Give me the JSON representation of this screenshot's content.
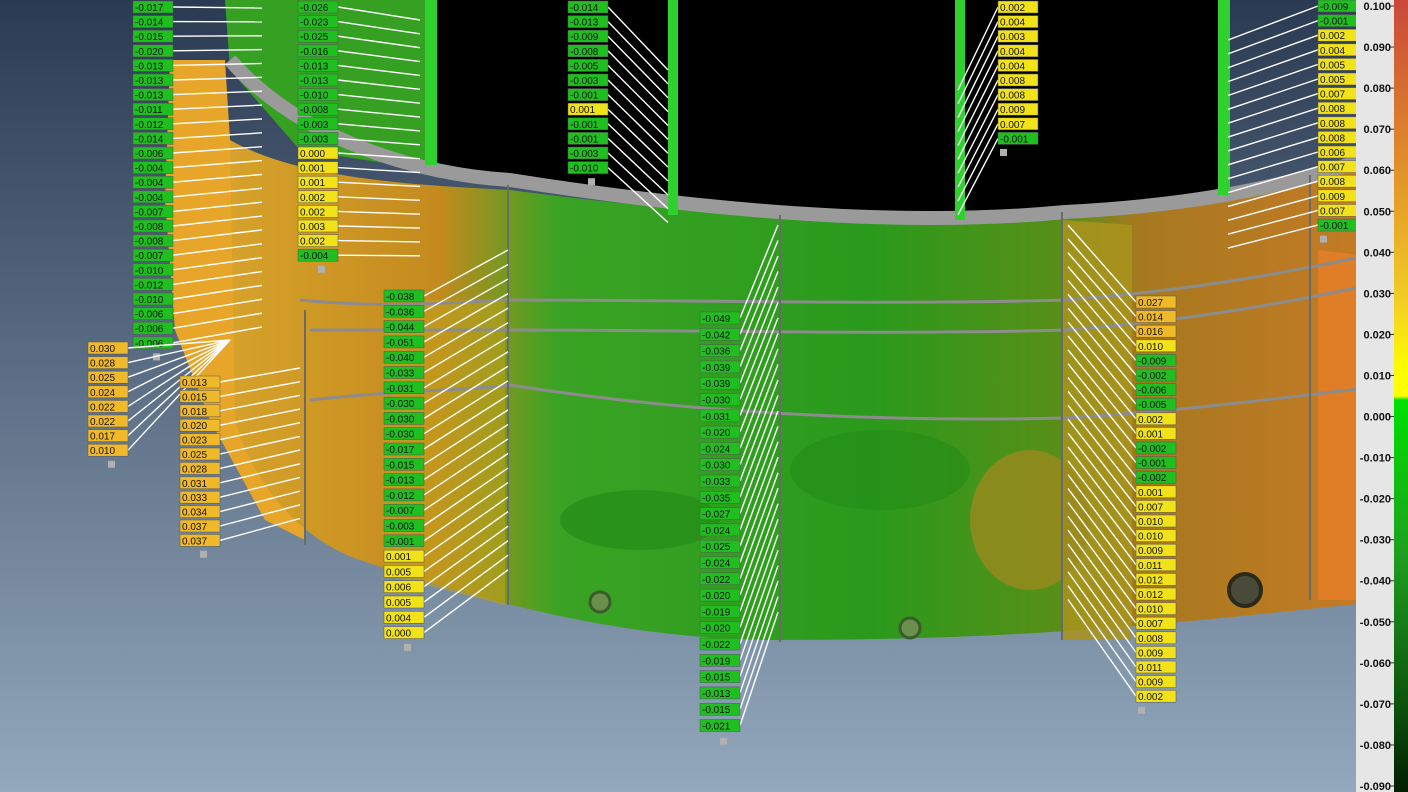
{
  "colors": {
    "bg_top": "#2a3a52",
    "bg_bottom": "#93a8bd",
    "green_label": "#1fbf1f",
    "yellow_label": "#f2e21a",
    "orange_label": "#f0b92a",
    "leader": "#ffffff",
    "surface_green": "#2e9c1e",
    "surface_olive": "#8a8a18",
    "surface_orange": "#d88a22",
    "weld_gray": "#9a9a9a"
  },
  "colorbar": {
    "ticks": [
      "0.100",
      "0.090",
      "0.080",
      "0.070",
      "0.060",
      "0.050",
      "0.040",
      "0.030",
      "0.020",
      "0.010",
      "0.000",
      "-0.010",
      "-0.020",
      "-0.030",
      "-0.040",
      "-0.050",
      "-0.060",
      "-0.070",
      "-0.080",
      "-0.090"
    ],
    "stops": [
      "#c9483a",
      "#d05f30",
      "#da7a2a",
      "#e5952a",
      "#eeb12a",
      "#f3cd24",
      "#f7e81a",
      "#ffff00",
      "#00e000",
      "#12c912",
      "#1fb31f",
      "#1f9f1f",
      "#1b8c1b",
      "#167816",
      "#116311",
      "#0c500c",
      "#083f08",
      "#043004",
      "#022402",
      "#011c01"
    ]
  },
  "columns": [
    {
      "id": "col-a",
      "color": "green",
      "values": [
        "-0.017",
        "-0.014",
        "-0.015",
        "-0.020",
        "-0.013",
        "-0.013",
        "-0.013",
        "-0.011",
        "-0.012",
        "-0.014",
        "-0.006",
        "-0.004",
        "-0.004",
        "-0.004",
        "-0.007",
        "-0.008",
        "-0.008",
        "-0.007",
        "-0.010",
        "-0.012",
        "-0.010",
        "-0.006",
        "-0.006",
        "-0.006"
      ]
    },
    {
      "id": "col-b",
      "color": "orange",
      "values": [
        "0.030",
        "0.028",
        "0.025",
        "0.024",
        "0.022",
        "0.022",
        "0.017",
        "0.010"
      ]
    },
    {
      "id": "col-c",
      "color": "orange",
      "values": [
        "0.013",
        "0.015",
        "0.018",
        "0.020",
        "0.023",
        "0.025",
        "0.028",
        "0.031",
        "0.033",
        "0.034",
        "0.037",
        "0.037"
      ]
    },
    {
      "id": "col-d",
      "color": "mixed",
      "values": [
        "-0.026",
        "-0.023",
        "-0.025",
        "-0.016",
        "-0.013",
        "-0.013",
        "-0.010",
        "-0.008",
        "-0.003",
        "-0.003",
        "0.000",
        "0.001",
        "0.001",
        "0.002",
        "0.002",
        "0.003",
        "0.002",
        "-0.004"
      ]
    },
    {
      "id": "col-e",
      "color": "mixed",
      "values": [
        "-0.038",
        "-0.036",
        "-0.044",
        "-0.051",
        "-0.040",
        "-0.033",
        "-0.031",
        "-0.030",
        "-0.030",
        "-0.030",
        "-0.017",
        "-0.015",
        "-0.013",
        "-0.012",
        "-0.007",
        "-0.003",
        "-0.001",
        "0.001",
        "0.005",
        "0.006",
        "0.005",
        "0.004",
        "0.000"
      ]
    },
    {
      "id": "col-f",
      "color": "mixed",
      "values": [
        "-0.014",
        "-0.013",
        "-0.009",
        "-0.008",
        "-0.005",
        "-0.003",
        "-0.001",
        "0.001",
        "-0.001",
        "-0.001",
        "-0.003",
        "-0.010"
      ]
    },
    {
      "id": "col-g",
      "color": "green",
      "values": [
        "-0.049",
        "-0.042",
        "-0.036",
        "-0.039",
        "-0.039",
        "-0.030",
        "-0.031",
        "-0.020",
        "-0.024",
        "-0.030",
        "-0.033",
        "-0.035",
        "-0.027",
        "-0.024",
        "-0.025",
        "-0.024",
        "-0.022",
        "-0.020",
        "-0.019",
        "-0.020",
        "-0.022",
        "-0.019",
        "-0.015",
        "-0.013",
        "-0.015",
        "-0.021"
      ]
    },
    {
      "id": "col-h",
      "color": "mixed",
      "values": [
        "0.002",
        "0.004",
        "0.003",
        "0.004",
        "0.004",
        "0.008",
        "0.008",
        "0.009",
        "0.007",
        "-0.001"
      ]
    },
    {
      "id": "col-i",
      "color": "mixed",
      "values": [
        "0.027",
        "0.014",
        "0.016",
        "0.010",
        "-0.009",
        "-0.002",
        "-0.006",
        "-0.005",
        "0.002",
        "0.001",
        "-0.002",
        "-0.001",
        "-0.002",
        "0.001",
        "0.007",
        "0.010",
        "0.010",
        "0.009",
        "0.011",
        "0.012",
        "0.012",
        "0.010",
        "0.007",
        "0.008",
        "0.009",
        "0.011",
        "0.009",
        "0.002"
      ]
    },
    {
      "id": "col-j",
      "color": "mixed",
      "values": [
        "-0.009",
        "-0.001",
        "0.002",
        "0.004",
        "0.005",
        "0.005",
        "0.007",
        "0.008",
        "0.008",
        "0.008",
        "0.006",
        "0.007",
        "0.008",
        "0.009",
        "0.007",
        "-0.001"
      ]
    }
  ]
}
